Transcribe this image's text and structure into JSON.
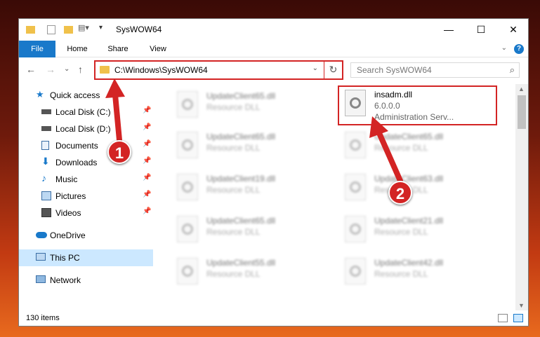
{
  "window": {
    "title": "SysWOW64"
  },
  "ribbon": {
    "tabs": [
      "File",
      "Home",
      "Share",
      "View"
    ],
    "help": "?"
  },
  "address": {
    "path": "C:\\Windows\\SysWOW64",
    "search_placeholder": "Search SysWOW64"
  },
  "sidebar": {
    "quick_access": "Quick access",
    "items": [
      {
        "label": "Local Disk (C:)",
        "icon": "drive-icon"
      },
      {
        "label": "Local Disk (D:)",
        "icon": "drive-icon"
      },
      {
        "label": "Documents",
        "icon": "documents-icon"
      },
      {
        "label": "Downloads",
        "icon": "downloads-icon"
      },
      {
        "label": "Music",
        "icon": "music-icon"
      },
      {
        "label": "Pictures",
        "icon": "pictures-icon"
      },
      {
        "label": "Videos",
        "icon": "videos-icon"
      }
    ],
    "onedrive": "OneDrive",
    "this_pc": "This PC",
    "network": "Network"
  },
  "files": {
    "highlighted": {
      "name": "insadm.dll",
      "version": "6.0.0.0",
      "description": "Administration Serv..."
    },
    "left": [
      {
        "name": "UpdateClient65.dll",
        "type": "Resource DLL"
      },
      {
        "name": "UpdateClient65.dll",
        "type": "Resource DLL"
      },
      {
        "name": "UpdateClient19.dll",
        "type": "Resource DLL"
      },
      {
        "name": "UpdateClient65.dll",
        "type": "Resource DLL"
      },
      {
        "name": "UpdateClient55.dll",
        "type": "Resource DLL"
      }
    ],
    "right": [
      {
        "name": "UpdateClient65.dll",
        "type": "Resource DLL"
      },
      {
        "name": "UpdateClient63.dll",
        "type": "Resource DLL"
      },
      {
        "name": "UpdateClient21.dll",
        "type": "Resource DLL"
      },
      {
        "name": "UpdateClient42.dll",
        "type": "Resource DLL"
      }
    ]
  },
  "status": {
    "item_count": "130 items"
  },
  "annotations": {
    "step1": "1",
    "step2": "2",
    "accent": "#d32424"
  }
}
